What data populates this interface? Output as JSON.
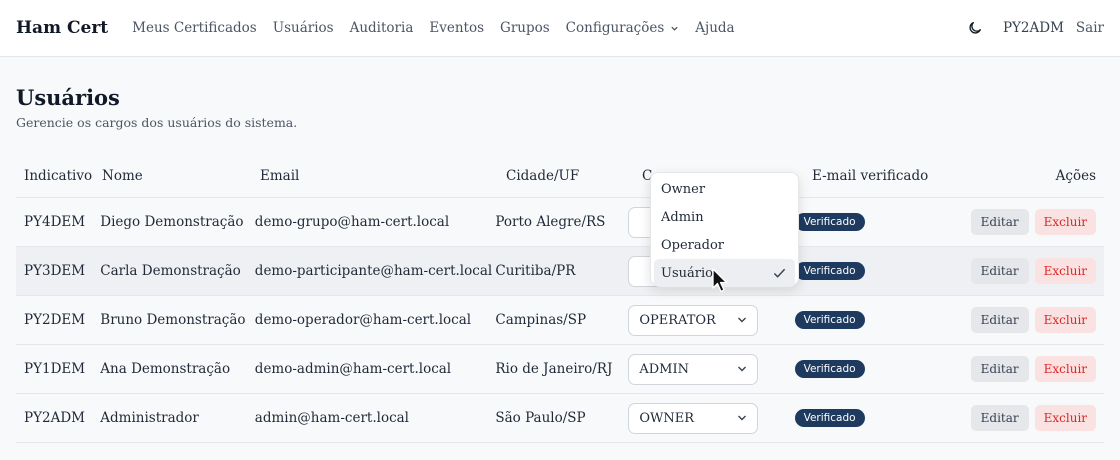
{
  "navbar": {
    "brand": "Ham Cert",
    "items": [
      {
        "label": "Meus Certificados"
      },
      {
        "label": "Usuários"
      },
      {
        "label": "Auditoria"
      },
      {
        "label": "Eventos"
      },
      {
        "label": "Grupos"
      },
      {
        "label": "Configurações"
      },
      {
        "label": "Ajuda"
      }
    ],
    "user": "PY2ADM",
    "logout": "Sair"
  },
  "page": {
    "title": "Usuários",
    "subtitle": "Gerencie os cargos dos usuários do sistema."
  },
  "table": {
    "headers": {
      "callsign": "Indicativo",
      "name": "Nome",
      "email": "Email",
      "city": "Cidade/UF",
      "role": "C",
      "verified": "E-mail verificado",
      "actions": "Ações"
    },
    "rows": [
      {
        "callsign": "PY4DEM",
        "name": "Diego Demonstração",
        "email": "demo-grupo@ham-cert.local",
        "city": "Porto Alegre/RS",
        "role": "",
        "verified": "Verificado",
        "edit": "Editar",
        "delete": "Excluir"
      },
      {
        "callsign": "PY3DEM",
        "name": "Carla Demonstração",
        "email": "demo-participante@ham-cert.local",
        "city": "Curitiba/PR",
        "role": "",
        "verified": "Verificado",
        "edit": "Editar",
        "delete": "Excluir"
      },
      {
        "callsign": "PY2DEM",
        "name": "Bruno Demonstração",
        "email": "demo-operador@ham-cert.local",
        "city": "Campinas/SP",
        "role": "OPERATOR",
        "verified": "Verificado",
        "edit": "Editar",
        "delete": "Excluir"
      },
      {
        "callsign": "PY1DEM",
        "name": "Ana Demonstração",
        "email": "demo-admin@ham-cert.local",
        "city": "Rio de Janeiro/RJ",
        "role": "ADMIN",
        "verified": "Verificado",
        "edit": "Editar",
        "delete": "Excluir"
      },
      {
        "callsign": "PY2ADM",
        "name": "Administrador",
        "email": "admin@ham-cert.local",
        "city": "São Paulo/SP",
        "role": "OWNER",
        "verified": "Verificado",
        "edit": "Editar",
        "delete": "Excluir"
      }
    ]
  },
  "dropdown": {
    "options": [
      "Owner",
      "Admin",
      "Operador",
      "Usuário"
    ],
    "selected": "Usuário"
  },
  "icons": {
    "theme_toggle": "moon-icon",
    "menu_chevron": "chevron-down-icon",
    "selected_check": "check-icon",
    "pointer": "mouse-cursor-icon"
  },
  "colors": {
    "badge_bg": "#1e3a5f",
    "delete_text": "#dc2626",
    "delete_bg": "#fbe2e2",
    "edit_bg": "#e5e7eb"
  }
}
